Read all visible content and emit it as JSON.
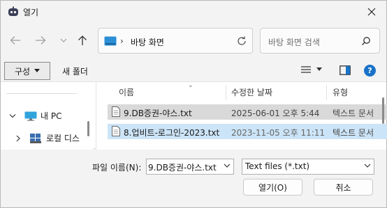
{
  "window": {
    "title": "열기",
    "accent": "#1a73c8"
  },
  "address": {
    "location": "바탕 화면",
    "separator": "›"
  },
  "search": {
    "placeholder": "바탕 화면 검색"
  },
  "toolbar": {
    "organize_label": "구성",
    "new_folder_label": "새 폴더",
    "help_label": "?"
  },
  "nav_pane": {
    "items": [
      {
        "label": "내 PC",
        "icon": "monitor-icon",
        "expanded": true
      },
      {
        "label": "로컬 디스",
        "icon": "drive-icon",
        "expanded": false
      }
    ]
  },
  "file_list": {
    "columns": [
      "이름",
      "수정한 날짜",
      "유형"
    ],
    "rows": [
      {
        "name": "9.DB증권-야스.txt",
        "modified": "2025-06-01 오후 5:44",
        "type": "텍스트 문서",
        "state": "hover"
      },
      {
        "name": "8.업비트-로그인-2023.txt",
        "modified": "2023-11-05 오후 11:11",
        "type": "텍스트 문서",
        "state": "selected"
      }
    ]
  },
  "footer": {
    "filename_label": "파일 이름(N):",
    "filename_value": "9.DB증권-야스.txt",
    "filetype_value": "Text files (*.txt)",
    "open_label": "열기(O)",
    "cancel_label": "취소"
  }
}
